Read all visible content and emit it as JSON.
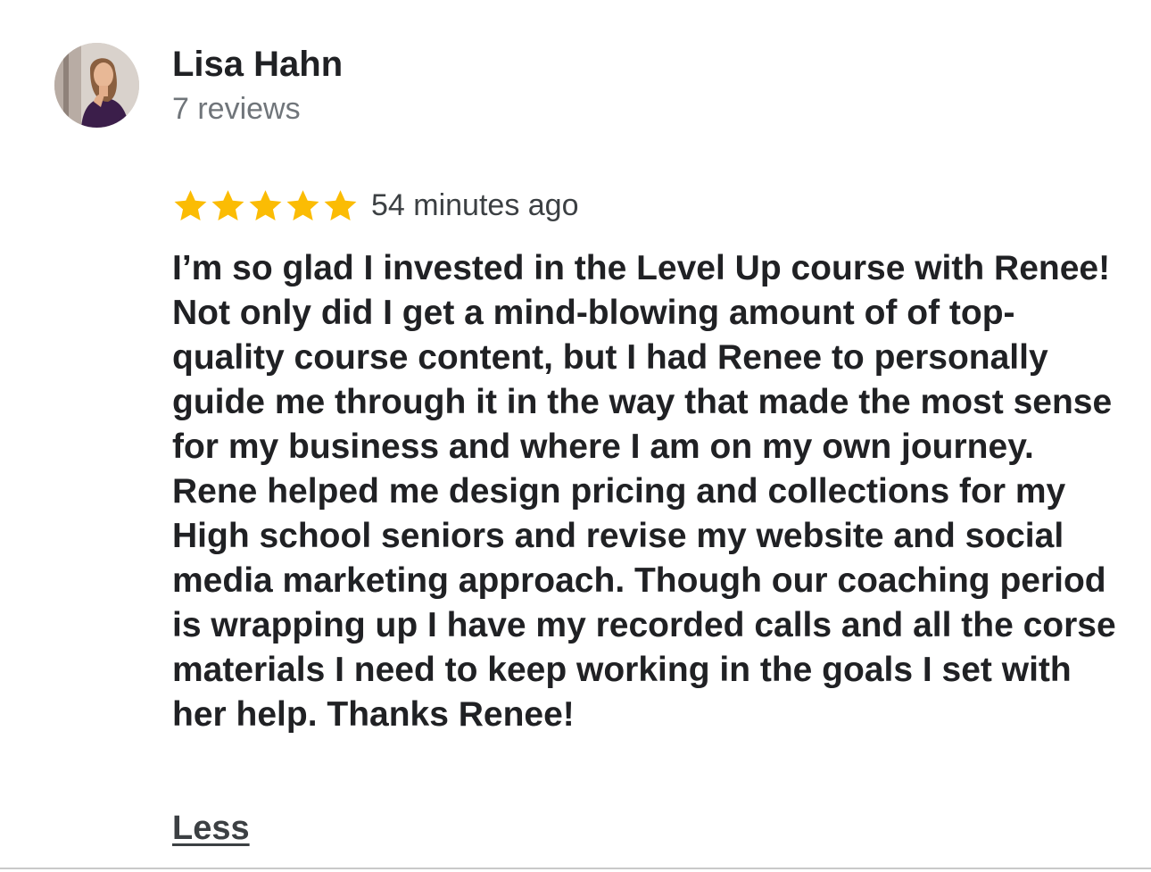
{
  "reviewer": {
    "name": "Lisa Hahn",
    "review_count": "7 reviews"
  },
  "review": {
    "rating": 5,
    "rating_max": 5,
    "time": "54 minutes ago",
    "text": "I’m so glad I invested in the Level Up course with Renee! Not only did I get a mind-blowing amount of of top-quality course content, but I had Renee to personally guide me through it in the way that made the most sense for my business and where I am on my own journey. Rene helped me design pricing and collections for my High school seniors and revise my website and social media marketing approach. Though our coaching period is wrapping up I have my recorded calls and all the corse materials I need to keep working in the goals I set with her help. Thanks Renee!",
    "collapse_label": "Less"
  },
  "icons": {
    "avatar": "avatar-photo",
    "star": "star-icon"
  },
  "colors": {
    "star": "#FBBC04",
    "name_text": "#202124",
    "secondary_text": "#70757a",
    "divider": "#c9c9c9"
  }
}
